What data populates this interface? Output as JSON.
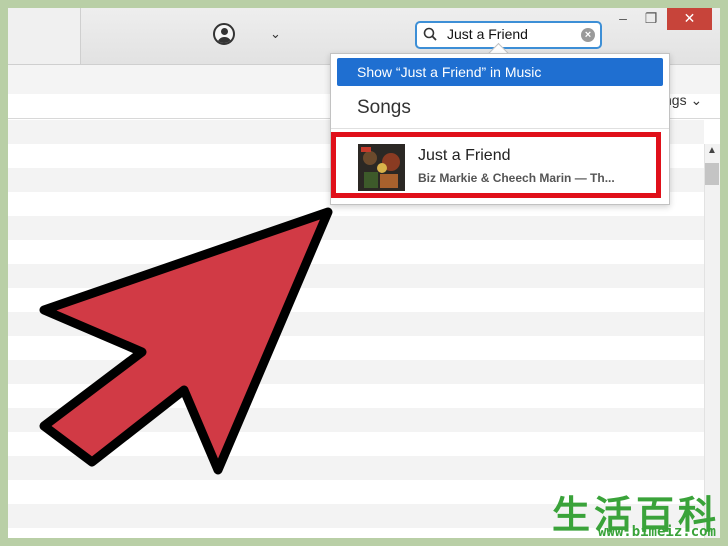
{
  "titlebar": {
    "account_icon": "user-circle-icon",
    "account_chevron": "⌄",
    "window_controls": {
      "minimize": "–",
      "maximize": "❐",
      "close": "✕"
    }
  },
  "search": {
    "value": "Just a Friend",
    "clear_icon": "×",
    "accent": "#3d8fd6"
  },
  "sort": {
    "partial_label": "ngs ⌄"
  },
  "dropdown": {
    "show_in_music": "Show “Just a Friend” in Music",
    "section_title": "Songs",
    "results": [
      {
        "title": "Just a Friend",
        "subtitle": "Biz Markie & Cheech Marin — Th..."
      }
    ],
    "highlight_color": "#1f6fd1",
    "callout_color": "#e0101a"
  },
  "annotation": {
    "arrow_color": "#d13a45"
  },
  "watermark": {
    "chinese": "生活百科",
    "url": "www.bimeiz.com"
  }
}
